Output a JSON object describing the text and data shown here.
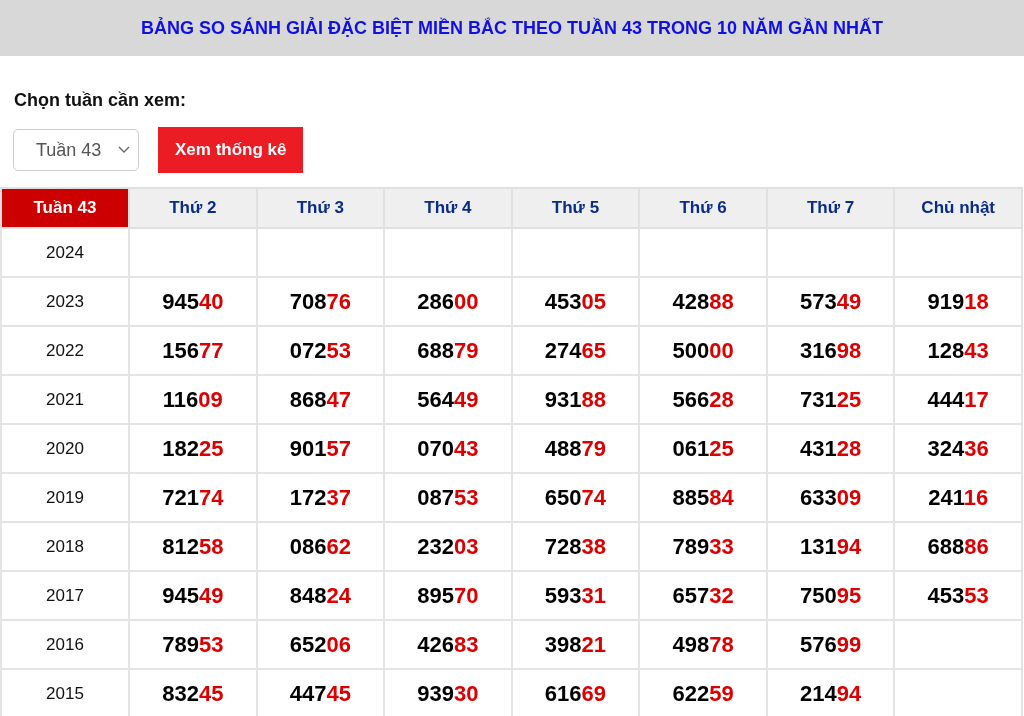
{
  "title": "BẢNG SO SÁNH GIẢI ĐẶC BIỆT MIỀN BẮC THEO TUẦN 43 TRONG 10 NĂM GẦN NHẤT",
  "picker": {
    "label": "Chọn tuần cần xem:",
    "select_value": "Tuần 43",
    "button": "Xem thống kê"
  },
  "table": {
    "columns": [
      "Tuần 43",
      "Thứ 2",
      "Thứ 3",
      "Thứ 4",
      "Thứ 5",
      "Thứ 6",
      "Thứ 7",
      "Chủ nhật"
    ],
    "rows": [
      {
        "cells": [
          "2024",
          "",
          "",
          "",
          "",
          "",
          "",
          ""
        ]
      },
      {
        "cells": [
          "2023",
          "94540",
          "70876",
          "28600",
          "45305",
          "42888",
          "57349",
          "91918"
        ]
      },
      {
        "cells": [
          "2022",
          "15677",
          "07253",
          "68879",
          "27465",
          "50000",
          "31698",
          "12843"
        ]
      },
      {
        "cells": [
          "2021",
          "11609",
          "86847",
          "56449",
          "93188",
          "56628",
          "73125",
          "44417"
        ]
      },
      {
        "cells": [
          "2020",
          "18225",
          "90157",
          "07043",
          "48879",
          "06125",
          "43128",
          "32436"
        ]
      },
      {
        "cells": [
          "2019",
          "72174",
          "17237",
          "08753",
          "65074",
          "88584",
          "63309",
          "24116"
        ]
      },
      {
        "cells": [
          "2018",
          "81258",
          "08662",
          "23203",
          "72838",
          "78933",
          "13194",
          "68886"
        ]
      },
      {
        "cells": [
          "2017",
          "94549",
          "84824",
          "89570",
          "59331",
          "65732",
          "75095",
          "45353"
        ]
      },
      {
        "cells": [
          "2016",
          "78953",
          "65206",
          "42683",
          "39821",
          "49878",
          "57699",
          ""
        ]
      },
      {
        "cells": [
          "2015",
          "83245",
          "44745",
          "93930",
          "61669",
          "62259",
          "21494",
          ""
        ]
      }
    ]
  }
}
